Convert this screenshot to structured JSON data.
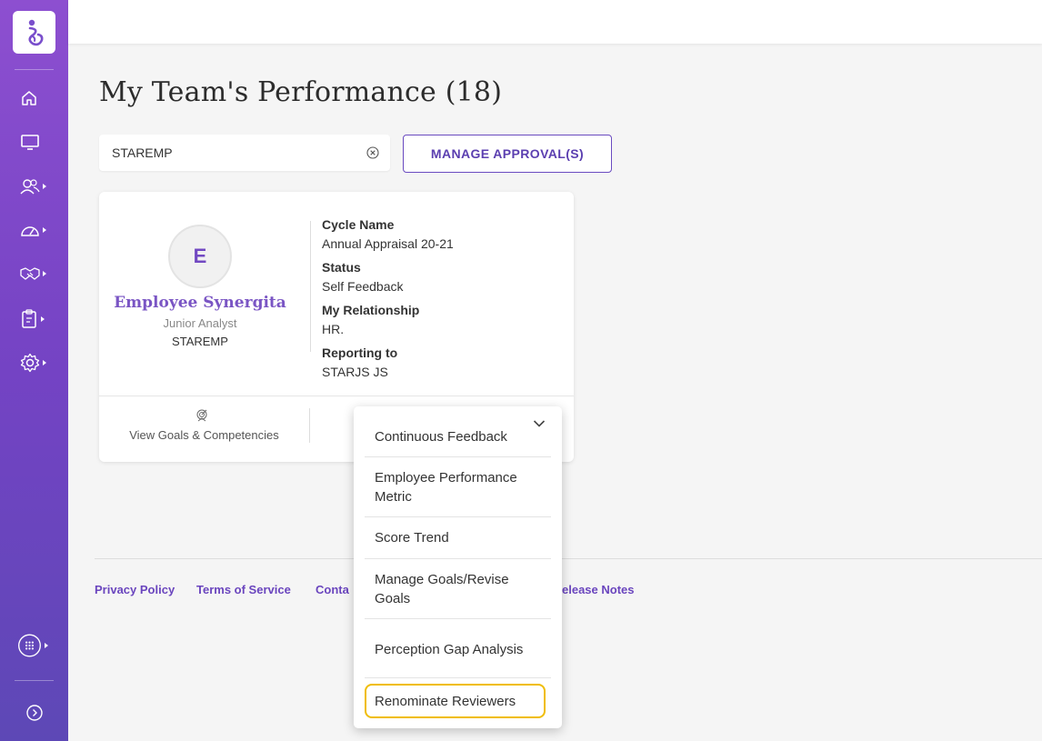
{
  "sidebar": {
    "icons": [
      "logo-icon",
      "home-icon",
      "monitor-icon",
      "team-icon",
      "dashboard-icon",
      "handshake-icon",
      "clipboard-icon",
      "settings-icon",
      "apps-icon",
      "expand-icon"
    ]
  },
  "page": {
    "title": "My Team's Performance (18)"
  },
  "search": {
    "value": "STAREMP",
    "clear_icon": "clear-circle-icon"
  },
  "actions": {
    "manage_approvals": "MANAGE APPROVAL(S)"
  },
  "employee_card": {
    "initial": "E",
    "name": "Employee Synergita",
    "role": "Junior Analyst",
    "code": "STAREMP",
    "fields": [
      {
        "label": "Cycle Name",
        "value": "Annual Appraisal 20-21"
      },
      {
        "label": "Status",
        "value": "Self Feedback"
      },
      {
        "label": "My Relationship",
        "value": "HR."
      },
      {
        "label": "Reporting to",
        "value": "STARJS JS"
      }
    ],
    "goals_link": "View Goals & Competencies"
  },
  "dropdown": {
    "items": [
      "Continuous Feedback",
      "Employee Performance Metric",
      "Score Trend",
      "Manage Goals/Revise Goals",
      "Perception Gap Analysis",
      "Renominate Reviewers"
    ],
    "highlighted": "Renominate Reviewers",
    "highlight_color": "#f0bd00"
  },
  "footer": {
    "links": [
      "Privacy Policy",
      "Terms of Service",
      "Conta",
      "elease Notes"
    ]
  },
  "colors": {
    "brand_purple": "#7a4fcc",
    "accent_text": "#6a45be"
  }
}
